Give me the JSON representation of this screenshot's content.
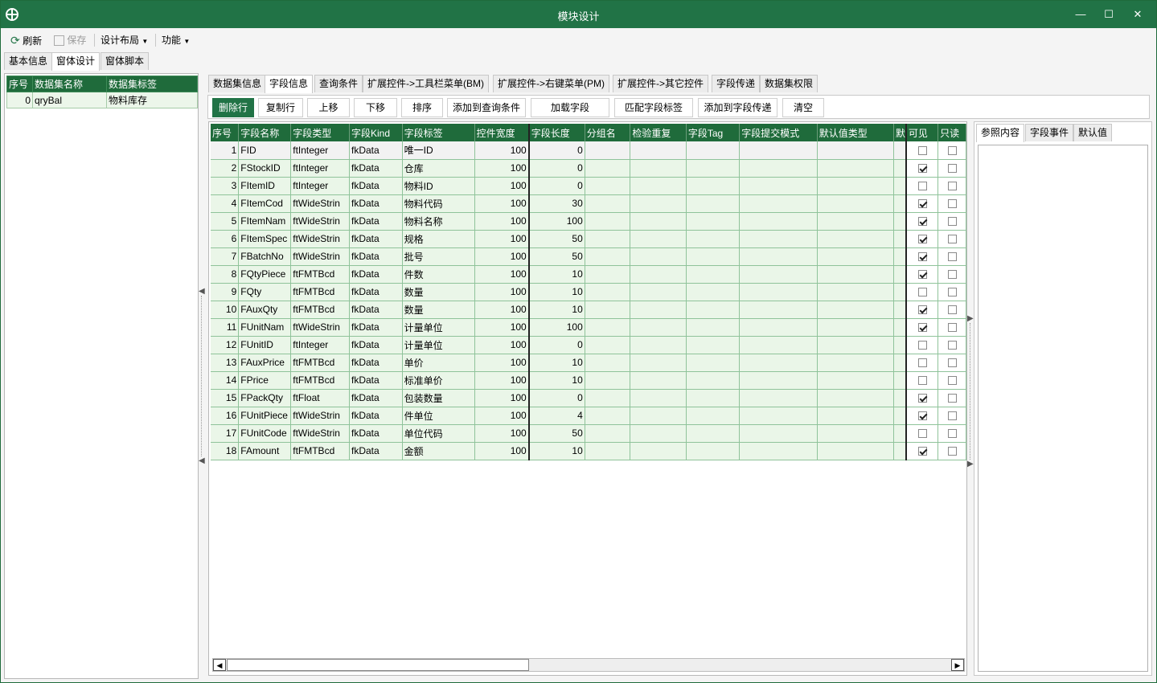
{
  "window": {
    "title": "模块设计",
    "minimize": "—",
    "maximize": "☐",
    "close": "✕"
  },
  "menu": {
    "refresh": "刷新",
    "save": "保存",
    "layout": "设计布局",
    "function": "功能"
  },
  "main_tabs": [
    "基本信息",
    "窗体设计",
    "窗体脚本"
  ],
  "left_table": {
    "headers": [
      "序号",
      "数据集名称",
      "数据集标签"
    ],
    "rows": [
      [
        "0",
        "qryBal",
        "物料库存"
      ]
    ]
  },
  "sub_tabs": [
    "数据集信息",
    "字段信息",
    "查询条件",
    "扩展控件->工具栏菜单(BM)",
    "扩展控件->右键菜单(PM)",
    "扩展控件->其它控件",
    "字段传递",
    "数据集权限"
  ],
  "toolbar": [
    "删除行",
    "复制行",
    "上移",
    "下移",
    "排序",
    "添加到查询条件",
    "加载字段",
    "匹配字段标签",
    "添加到字段传递",
    "清空"
  ],
  "grid": {
    "headers": [
      "序号",
      "字段名称",
      "字段类型",
      "字段Kind",
      "字段标签",
      "控件宽度",
      "字段长度",
      "分组名",
      "检验重复",
      "字段Tag",
      "字段提交模式",
      "默认值类型",
      "默",
      "可见",
      "只读"
    ],
    "rows": [
      {
        "no": "1",
        "name": "FID",
        "type": "ftInteger",
        "kind": "fkData",
        "label": "唯一ID",
        "width": "100",
        "len": "0",
        "visible": false,
        "readonly": false
      },
      {
        "no": "2",
        "name": "FStockID",
        "type": "ftInteger",
        "kind": "fkData",
        "label": "仓库",
        "width": "100",
        "len": "0",
        "visible": true,
        "readonly": false
      },
      {
        "no": "3",
        "name": "FItemID",
        "type": "ftInteger",
        "kind": "fkData",
        "label": "物料ID",
        "width": "100",
        "len": "0",
        "visible": false,
        "readonly": false
      },
      {
        "no": "4",
        "name": "FItemCod",
        "type": "ftWideStrin",
        "kind": "fkData",
        "label": "物料代码",
        "width": "100",
        "len": "30",
        "visible": true,
        "readonly": false
      },
      {
        "no": "5",
        "name": "FItemNam",
        "type": "ftWideStrin",
        "kind": "fkData",
        "label": "物料名称",
        "width": "100",
        "len": "100",
        "visible": true,
        "readonly": false
      },
      {
        "no": "6",
        "name": "FItemSpec",
        "type": "ftWideStrin",
        "kind": "fkData",
        "label": "规格",
        "width": "100",
        "len": "50",
        "visible": true,
        "readonly": false
      },
      {
        "no": "7",
        "name": "FBatchNo",
        "type": "ftWideStrin",
        "kind": "fkData",
        "label": "批号",
        "width": "100",
        "len": "50",
        "visible": true,
        "readonly": false
      },
      {
        "no": "8",
        "name": "FQtyPiece",
        "type": "ftFMTBcd",
        "kind": "fkData",
        "label": "件数",
        "width": "100",
        "len": "10",
        "visible": true,
        "readonly": false
      },
      {
        "no": "9",
        "name": "FQty",
        "type": "ftFMTBcd",
        "kind": "fkData",
        "label": "数量",
        "width": "100",
        "len": "10",
        "visible": false,
        "readonly": false
      },
      {
        "no": "10",
        "name": "FAuxQty",
        "type": "ftFMTBcd",
        "kind": "fkData",
        "label": "数量",
        "width": "100",
        "len": "10",
        "visible": true,
        "readonly": false
      },
      {
        "no": "11",
        "name": "FUnitNam",
        "type": "ftWideStrin",
        "kind": "fkData",
        "label": "计量单位",
        "width": "100",
        "len": "100",
        "visible": true,
        "readonly": false
      },
      {
        "no": "12",
        "name": "FUnitID",
        "type": "ftInteger",
        "kind": "fkData",
        "label": "计量单位",
        "width": "100",
        "len": "0",
        "visible": false,
        "readonly": false
      },
      {
        "no": "13",
        "name": "FAuxPrice",
        "type": "ftFMTBcd",
        "kind": "fkData",
        "label": "单价",
        "width": "100",
        "len": "10",
        "visible": false,
        "readonly": false
      },
      {
        "no": "14",
        "name": "FPrice",
        "type": "ftFMTBcd",
        "kind": "fkData",
        "label": "标准单价",
        "width": "100",
        "len": "10",
        "visible": false,
        "readonly": false
      },
      {
        "no": "15",
        "name": "FPackQty",
        "type": "ftFloat",
        "kind": "fkData",
        "label": "包装数量",
        "width": "100",
        "len": "0",
        "visible": true,
        "readonly": false
      },
      {
        "no": "16",
        "name": "FUnitPiece",
        "type": "ftWideStrin",
        "kind": "fkData",
        "label": "件单位",
        "width": "100",
        "len": "4",
        "visible": true,
        "readonly": false
      },
      {
        "no": "17",
        "name": "FUnitCode",
        "type": "ftWideStrin",
        "kind": "fkData",
        "label": "单位代码",
        "width": "100",
        "len": "50",
        "visible": false,
        "readonly": false
      },
      {
        "no": "18",
        "name": "FAmount",
        "type": "ftFMTBcd",
        "kind": "fkData",
        "label": "金额",
        "width": "100",
        "len": "10",
        "visible": true,
        "readonly": false
      }
    ]
  },
  "ref_tabs": [
    "参照内容",
    "字段事件",
    "默认值"
  ],
  "colors": {
    "accent": "#217346",
    "header": "#1f6b3b",
    "row": "#eaf6e8"
  }
}
